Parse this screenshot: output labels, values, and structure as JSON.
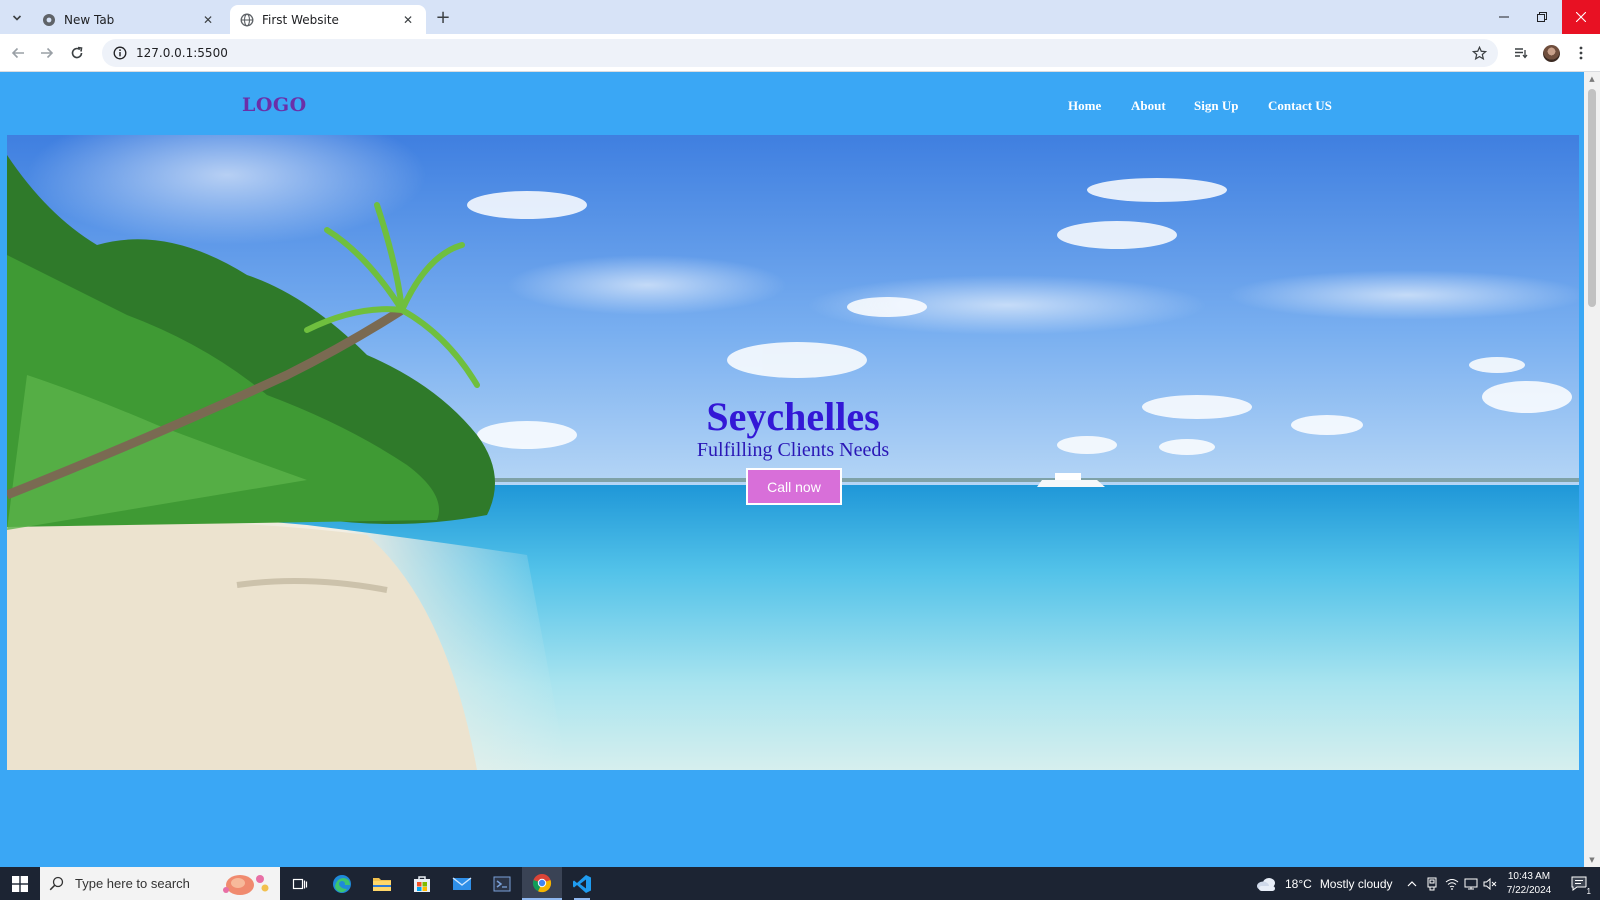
{
  "browser": {
    "tabs": [
      {
        "title": "New Tab",
        "active": false
      },
      {
        "title": "First Website",
        "active": true
      }
    ],
    "url": "127.0.0.1:5500"
  },
  "page": {
    "logo": "LOGO",
    "nav": [
      {
        "label": "Home"
      },
      {
        "label": "About"
      },
      {
        "label": "Sign Up"
      },
      {
        "label": "Contact US"
      }
    ],
    "hero": {
      "title": "Seychelles",
      "subtitle": "Fulfilling Clients Needs",
      "cta_label": "Call now"
    },
    "colors": {
      "page_background": "#3aa7f5",
      "logo": "#6b2fa8",
      "hero_title": "#3318d6",
      "cta_background": "#d86fd9"
    }
  },
  "taskbar": {
    "search_placeholder": "Type here to search",
    "apps": [
      "task-view",
      "edge",
      "file-explorer",
      "microsoft-store",
      "mail",
      "terminal",
      "chrome",
      "vscode"
    ],
    "weather": {
      "temp": "18°C",
      "condition": "Mostly cloudy"
    },
    "clock": {
      "time": "10:43 AM",
      "date": "7/22/2024"
    },
    "notification_count": "1"
  }
}
